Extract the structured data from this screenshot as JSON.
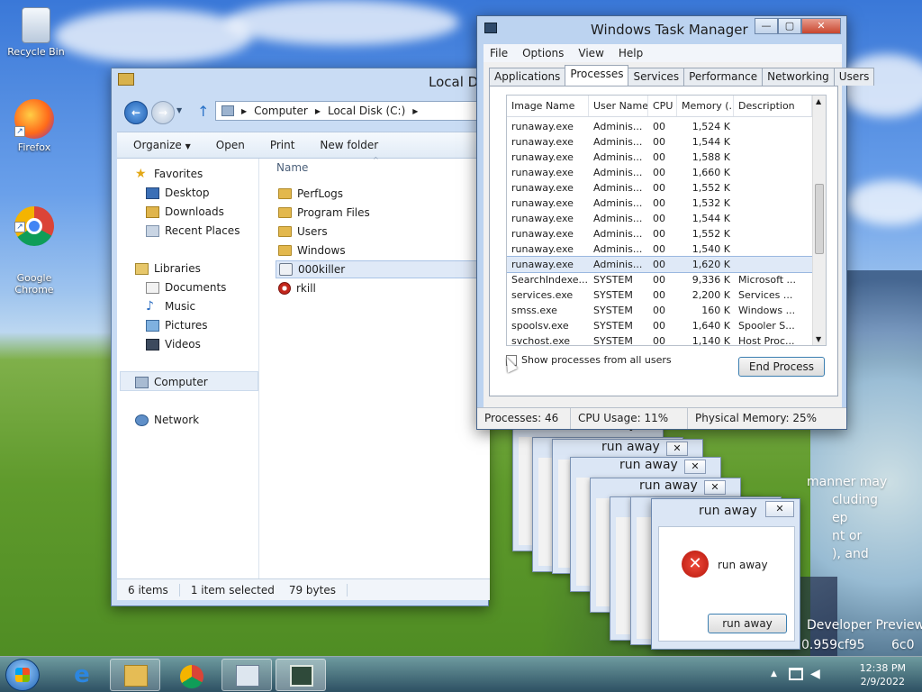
{
  "desktop": {
    "icons": [
      {
        "label": "Recycle Bin",
        "icon": "recycle-bin-icon"
      },
      {
        "label": "Firefox",
        "icon": "firefox-icon"
      },
      {
        "label": "Google\nChrome",
        "icon": "chrome-icon"
      }
    ],
    "wallpaper_text": [
      "manner may",
      "cluding",
      "ep",
      "nt or",
      "), and",
      "Developer Preview",
      "0.959cf95",
      "6c0"
    ]
  },
  "explorer": {
    "title": "Local Disk (C:)",
    "breadcrumb": [
      "Computer",
      "Local Disk (C:)"
    ],
    "toolbar": {
      "organize": "Organize",
      "open": "Open",
      "print": "Print",
      "new_folder": "New folder"
    },
    "nav": {
      "favorites": "Favorites",
      "desktop": "Desktop",
      "downloads": "Downloads",
      "recent_places": "Recent Places",
      "libraries": "Libraries",
      "documents": "Documents",
      "music": "Music",
      "pictures": "Pictures",
      "videos": "Videos",
      "computer": "Computer",
      "network": "Network"
    },
    "column_header": "Name",
    "files": [
      {
        "name": "PerfLogs",
        "type": "folder"
      },
      {
        "name": "Program Files",
        "type": "folder"
      },
      {
        "name": "Users",
        "type": "folder"
      },
      {
        "name": "Windows",
        "type": "folder"
      },
      {
        "name": "000killer",
        "type": "file",
        "selected": true
      },
      {
        "name": "rkill",
        "type": "file"
      }
    ],
    "status": {
      "count": "6 items",
      "selection": "1 item selected",
      "size": "79 bytes"
    }
  },
  "task_manager": {
    "title": "Windows Task Manager",
    "menu": [
      "File",
      "Options",
      "View",
      "Help"
    ],
    "tabs": [
      "Applications",
      "Processes",
      "Services",
      "Performance",
      "Networking",
      "Users"
    ],
    "active_tab": "Processes",
    "columns": [
      "Image Name",
      "User Name",
      "CPU",
      "Memory (...",
      "Description"
    ],
    "processes": [
      {
        "name": "runaway.exe",
        "user": "Adminis...",
        "cpu": "00",
        "mem": "1,524 K",
        "desc": ""
      },
      {
        "name": "runaway.exe",
        "user": "Adminis...",
        "cpu": "00",
        "mem": "1,544 K",
        "desc": ""
      },
      {
        "name": "runaway.exe",
        "user": "Adminis...",
        "cpu": "00",
        "mem": "1,588 K",
        "desc": ""
      },
      {
        "name": "runaway.exe",
        "user": "Adminis...",
        "cpu": "00",
        "mem": "1,660 K",
        "desc": ""
      },
      {
        "name": "runaway.exe",
        "user": "Adminis...",
        "cpu": "00",
        "mem": "1,552 K",
        "desc": ""
      },
      {
        "name": "runaway.exe",
        "user": "Adminis...",
        "cpu": "00",
        "mem": "1,532 K",
        "desc": ""
      },
      {
        "name": "runaway.exe",
        "user": "Adminis...",
        "cpu": "00",
        "mem": "1,544 K",
        "desc": ""
      },
      {
        "name": "runaway.exe",
        "user": "Adminis...",
        "cpu": "00",
        "mem": "1,552 K",
        "desc": ""
      },
      {
        "name": "runaway.exe",
        "user": "Adminis...",
        "cpu": "00",
        "mem": "1,540 K",
        "desc": ""
      },
      {
        "name": "runaway.exe",
        "user": "Adminis...",
        "cpu": "00",
        "mem": "1,620 K",
        "desc": "",
        "selected": true
      },
      {
        "name": "SearchIndexe...",
        "user": "SYSTEM",
        "cpu": "00",
        "mem": "9,336 K",
        "desc": "Microsoft ..."
      },
      {
        "name": "services.exe",
        "user": "SYSTEM",
        "cpu": "00",
        "mem": "2,200 K",
        "desc": "Services ..."
      },
      {
        "name": "smss.exe",
        "user": "SYSTEM",
        "cpu": "00",
        "mem": "160 K",
        "desc": "Windows ..."
      },
      {
        "name": "spoolsv.exe",
        "user": "SYSTEM",
        "cpu": "00",
        "mem": "1,640 K",
        "desc": "Spooler S..."
      },
      {
        "name": "svchost.exe",
        "user": "SYSTEM",
        "cpu": "00",
        "mem": "1,140 K",
        "desc": "Host Proc..."
      }
    ],
    "show_all_label": "Show processes from all users",
    "end_process_label": "End Process",
    "status": {
      "processes": "Processes: 46",
      "cpu": "CPU Usage: 11%",
      "memory": "Physical Memory: 25%"
    }
  },
  "popups": {
    "title": "run away",
    "message": "run away",
    "button": "run away",
    "close_glyph": "✕"
  },
  "taskbar": {
    "time": "12:38 PM",
    "date": "2/9/2022"
  }
}
